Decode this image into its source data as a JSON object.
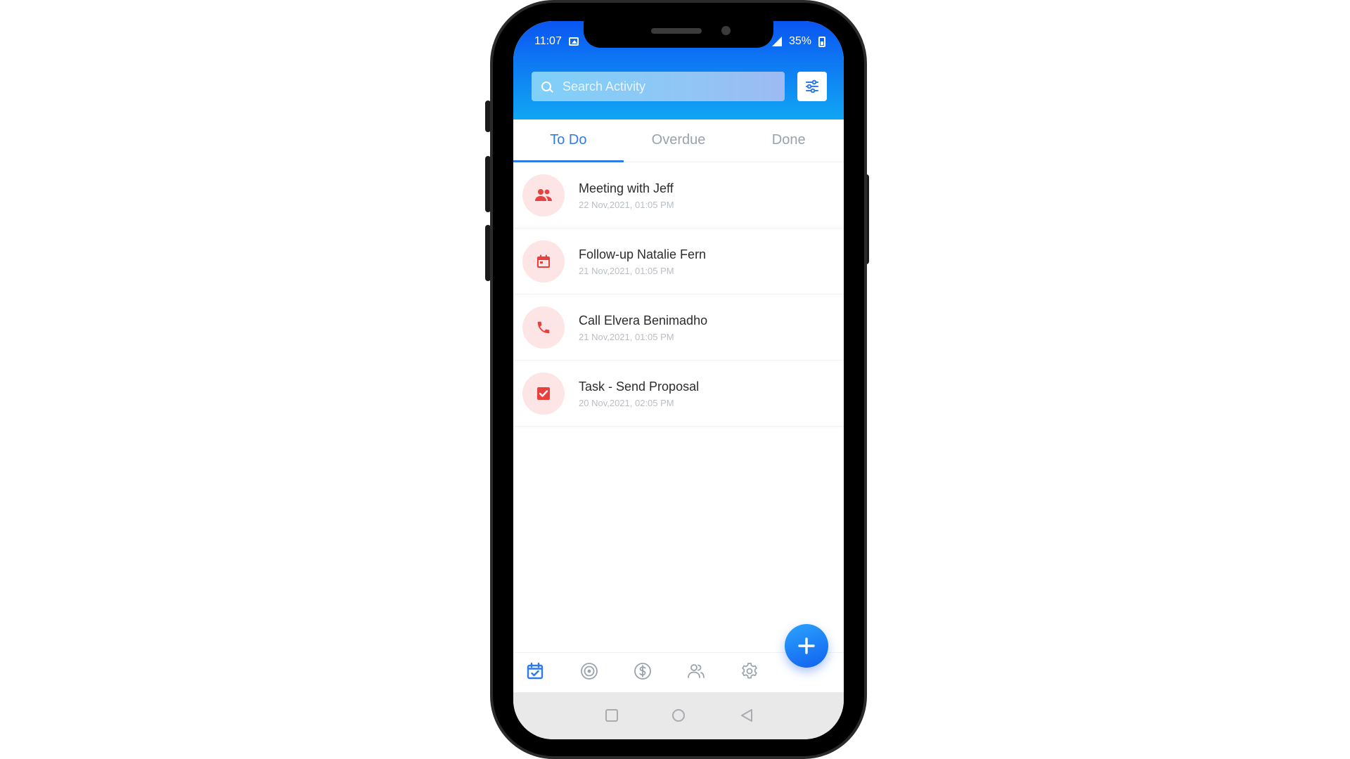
{
  "status_bar": {
    "time": "11:07",
    "battery": "35%"
  },
  "search": {
    "placeholder": "Search Activity"
  },
  "tabs": [
    {
      "label": "To Do",
      "active": true
    },
    {
      "label": "Overdue",
      "active": false
    },
    {
      "label": "Done",
      "active": false
    }
  ],
  "activities": [
    {
      "title": "Meeting with Jeff",
      "date": "22 Nov,2021, 01:05 PM",
      "icon": "group-icon"
    },
    {
      "title": "Follow-up Natalie Fern",
      "date": "21 Nov,2021, 01:05 PM",
      "icon": "calendar-icon"
    },
    {
      "title": "Call Elvera Benimadho",
      "date": "21 Nov,2021, 01:05 PM",
      "icon": "phone-icon"
    },
    {
      "title": "Task - Send Proposal",
      "date": "20 Nov,2021, 02:05 PM",
      "icon": "checkbox-icon"
    }
  ],
  "bottom_nav": [
    {
      "icon": "activity-check-icon",
      "active": true
    },
    {
      "icon": "target-icon",
      "active": false
    },
    {
      "icon": "dollar-icon",
      "active": false
    },
    {
      "icon": "contacts-icon",
      "active": false
    },
    {
      "icon": "settings-gear-icon",
      "active": false
    }
  ],
  "colors": {
    "header_top": "#0a55f2",
    "header_bottom": "#11a6f3",
    "accent": "#2f7be8",
    "activity_icon": "#e8403f",
    "activity_icon_bg": "#fde5e5"
  }
}
